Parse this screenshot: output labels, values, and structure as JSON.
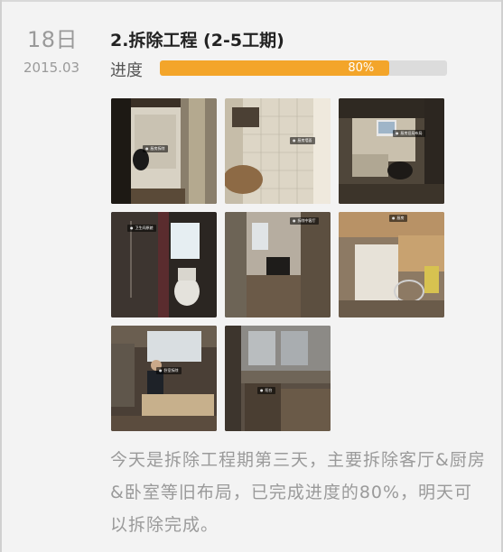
{
  "entry": {
    "date_day": "18日",
    "date_year_month": "2015.03",
    "stage_title": "2.拆除工程 (2-5工期)",
    "progress": {
      "label": "进度",
      "percent": 80,
      "percent_text": "80%",
      "fill_color": "#f3a52a",
      "track_color": "#dcdcdc"
    },
    "photos": [
      {
        "name": "photo-kitchen-doorway",
        "tag": "厨房拆除"
      },
      {
        "name": "photo-kitchen-wall",
        "tag": "厨房墙面"
      },
      {
        "name": "photo-kitchen-desk",
        "tag": "厨房旧局布局"
      },
      {
        "name": "photo-bathroom",
        "tag": "卫生间原貌"
      },
      {
        "name": "photo-room-interior",
        "tag": "拆除中客厅"
      },
      {
        "name": "photo-kitchen-corner",
        "tag": "厨房"
      },
      {
        "name": "photo-bedroom-worker",
        "tag": "卧室拆除"
      },
      {
        "name": "photo-window-room",
        "tag": "阳台"
      }
    ],
    "description": "今天是拆除工程期第三天，主要拆除客厅&厨房&卧室等旧布局，已完成进度的80%，明天可以拆除完成。"
  }
}
